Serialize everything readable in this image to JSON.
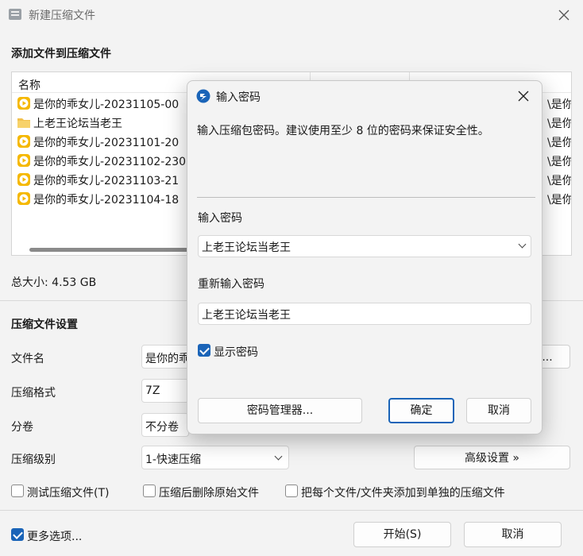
{
  "window": {
    "title": "新建压缩文件",
    "add_files_heading": "添加文件到压缩文件"
  },
  "file_list": {
    "columns": {
      "name": "名称"
    },
    "rows": [
      {
        "name": "是你的乖女儿-20231105-00",
        "path": "\\是你",
        "icon": "video-file-icon"
      },
      {
        "name": "上老王论坛当老王",
        "path": "\\是你",
        "icon": "folder-icon"
      },
      {
        "name": "是你的乖女儿-20231101-20",
        "path": "\\是你",
        "icon": "video-file-icon"
      },
      {
        "name": "是你的乖女儿-20231102-230",
        "path": "\\是你",
        "icon": "video-file-icon"
      },
      {
        "name": "是你的乖女儿-20231103-21",
        "path": "\\是你",
        "icon": "video-file-icon"
      },
      {
        "name": "是你的乖女儿-20231104-18",
        "path": "\\是你",
        "icon": "video-file-icon"
      }
    ]
  },
  "total_size": "总大小: 4.53 GB",
  "settings": {
    "heading": "压缩文件设置",
    "filename_label": "文件名",
    "filename_value": "是你的乖",
    "browse_label": "...",
    "format_label": "压缩格式",
    "format_value": "7Z",
    "split_label": "分卷",
    "split_value": "不分卷",
    "level_label": "压缩级别",
    "level_value": "1-快速压缩",
    "advanced_label": "高级设置 »"
  },
  "options": {
    "test": "测试压缩文件(T)",
    "delete_after": "压缩后删除原始文件",
    "separate": "把每个文件/文件夹添加到单独的压缩文件",
    "more": "更多选项..."
  },
  "footer": {
    "start": "开始(S)",
    "cancel": "取消"
  },
  "dialog": {
    "title": "输入密码",
    "hint": "输入压缩包密码。建议使用至少 8 位的密码来保证安全性。",
    "password_label": "输入密码",
    "password_value": "上老王论坛当老王",
    "confirm_label": "重新输入密码",
    "confirm_value": "上老王论坛当老王",
    "show_password": "显示密码",
    "manager_button": "密码管理器...",
    "ok_button": "确定",
    "cancel_button": "取消"
  },
  "colors": {
    "accent": "#1a64b8",
    "video_icon": "#f5b800"
  }
}
